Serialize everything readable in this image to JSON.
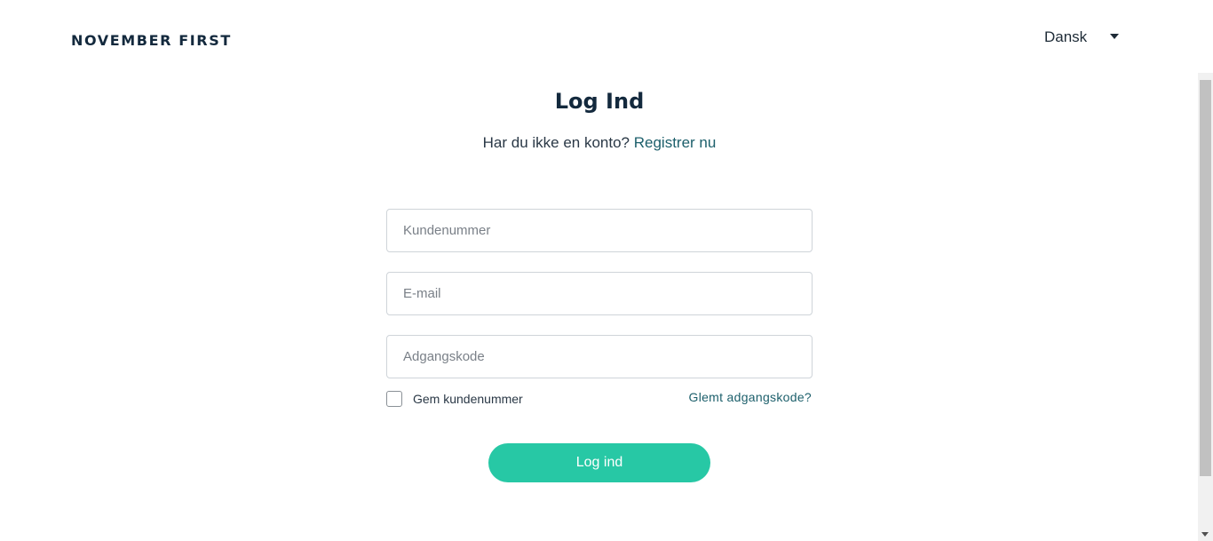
{
  "header": {
    "logo": "NOVEMBER FIRST",
    "language": {
      "selected": "Dansk",
      "icon": "caret-down-icon"
    }
  },
  "login": {
    "title": "Log Ind",
    "subtitle_text": "Har du ikke en konto?",
    "register_link": "Registrer nu",
    "fields": {
      "customer_number_placeholder": "Kundenummer",
      "email_placeholder": "E-mail",
      "password_placeholder": "Adgangskode"
    },
    "remember_label": "Gem kundenummer",
    "remember_checked": false,
    "forgot_link": "Glemt adgangskode?",
    "submit_label": "Log ind"
  },
  "colors": {
    "accent": "#27c8a5",
    "link": "#1c5f6b",
    "heading": "#13293d"
  }
}
